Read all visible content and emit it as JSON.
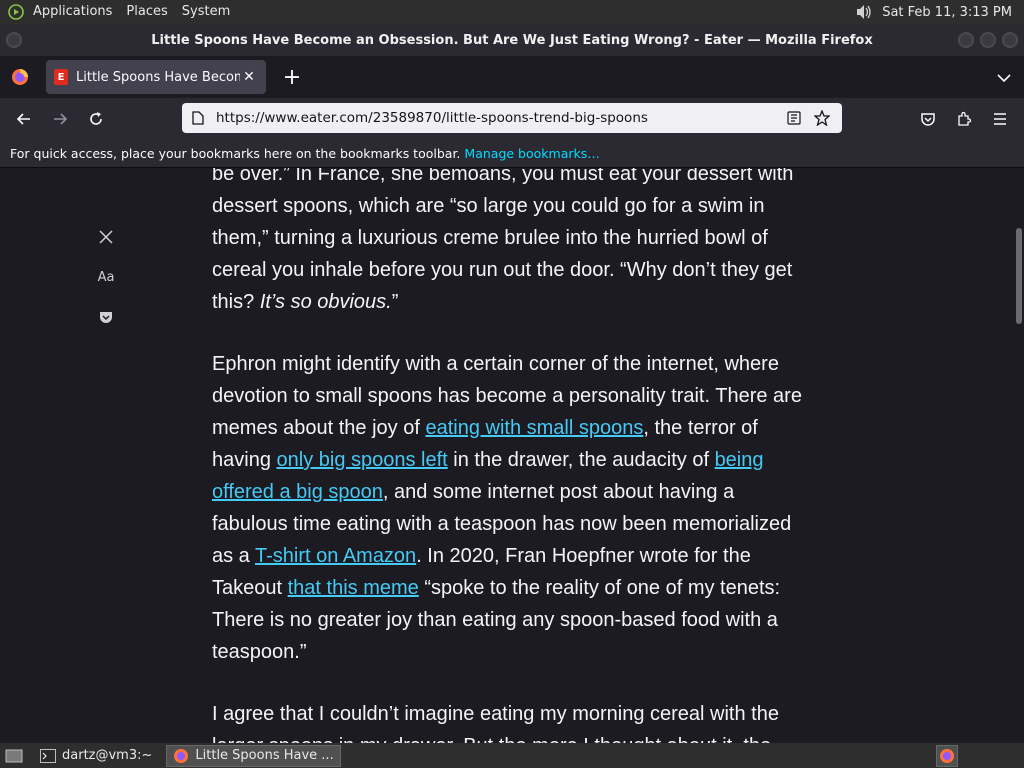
{
  "top_panel": {
    "menus": [
      "Applications",
      "Places",
      "System"
    ],
    "clock": "Sat Feb 11,  3:13 PM"
  },
  "window": {
    "title": "Little Spoons Have Become an Obsession. But Are We Just Eating Wrong? - Eater — Mozilla Firefox"
  },
  "tabs": [
    {
      "label": "Little Spoons Have Become an Obsession. But Are We Just Eating Wrong? - Eater",
      "favicon_text": "E"
    }
  ],
  "navbar": {
    "url": "https://www.eater.com/23589870/little-spoons-trend-big-spoons"
  },
  "bookmarks_bar": {
    "message": "For quick access, place your bookmarks here on the bookmarks toolbar.",
    "manage_link": "Manage bookmarks…"
  },
  "reader": {
    "font_label": "Aa",
    "p1_a": "be over.” In France, she bemoans, you must eat your dessert with dessert spoons, which are “so large you could go for a swim in them,” turning a luxurious creme brulee into the hurried bowl of cereal you inhale before you run out the door. “Why don’t they get this? ",
    "p1_em": "It’s so obvious.",
    "p1_b": "”",
    "p2_t1": "Ephron might identify with a certain corner of the internet, where devotion to small spoons has become a personality trait. There are memes about the joy of ",
    "p2_l1": "eating with small spoons",
    "p2_t2": ", the terror of having ",
    "p2_l2": "only big spoons left",
    "p2_t3": " in the drawer, the audacity of ",
    "p2_l3": "being offered a big spoon",
    "p2_t4": ", and some internet post about having a fabulous time eating with a teaspoon has now been memorialized as a ",
    "p2_l4": "T-shirt on Amazon",
    "p2_t5": ". In 2020, Fran Hoepfner wrote for the Takeout ",
    "p2_l5": "that this meme",
    "p2_t6": " “spoke to the reality of one of my tenets: There is no greater joy than eating any spoon-based food with a teaspoon.”",
    "p3": "I agree that I couldn’t imagine eating my morning cereal with the larger spoons in my drawer. But the more I thought about it, the"
  },
  "taskbar": {
    "tasks": [
      {
        "label": "dartz@vm3:~"
      },
      {
        "label": "Little Spoons Have ..."
      }
    ]
  },
  "colors": {
    "link": "#45c9f5",
    "page_bg": "#1c1b22",
    "toolbar_bg": "#2b2a33"
  }
}
